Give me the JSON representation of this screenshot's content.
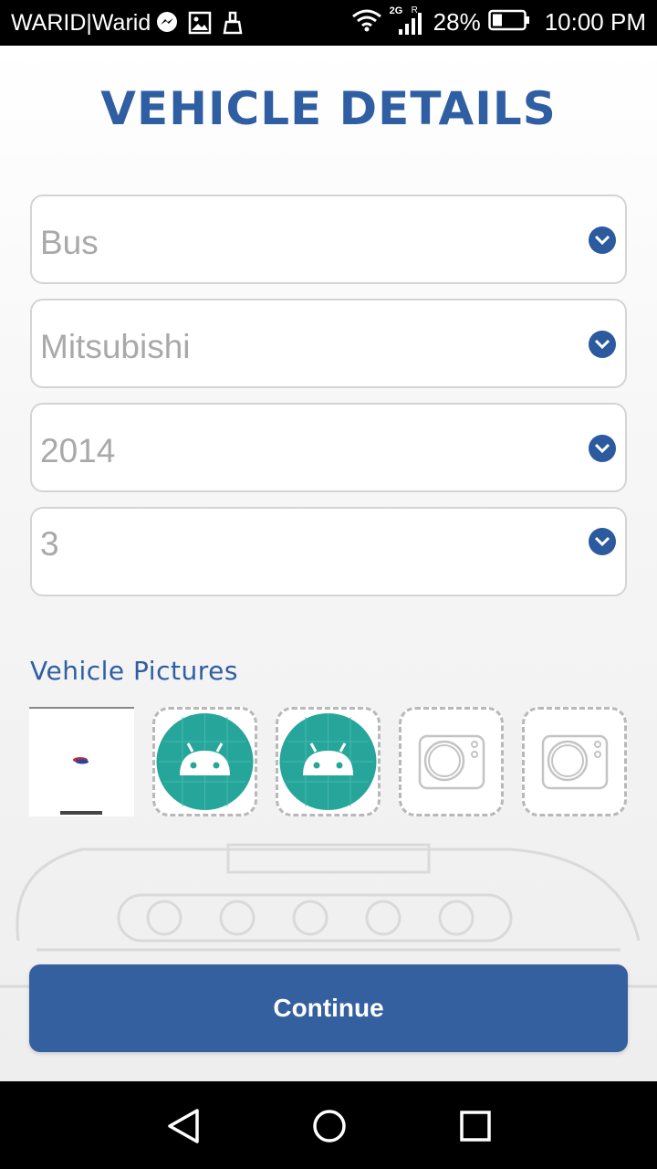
{
  "status_bar": {
    "carrier": "WARID|Warid",
    "network": "2G",
    "roaming": "R",
    "battery": "28%",
    "time": "10:00 PM",
    "icons": [
      "messenger-icon",
      "image-icon",
      "cleaner-icon",
      "wifi-icon",
      "signal-icon",
      "battery-icon"
    ]
  },
  "page": {
    "title": "VEHICLE DETAILS"
  },
  "form": {
    "vehicle_type": "Bus",
    "make": "Mitsubishi",
    "year": "2014",
    "count": "3"
  },
  "pictures": {
    "label": "Vehicle Pictures",
    "slots": [
      "photo",
      "android-placeholder",
      "android-placeholder",
      "camera-add",
      "camera-add"
    ]
  },
  "actions": {
    "continue_label": "Continue"
  },
  "colors": {
    "brand_blue": "#2f5ea3",
    "button_blue": "#34609f",
    "android_teal": "#26a69a"
  },
  "nav": {
    "icons": [
      "back-icon",
      "home-icon",
      "recents-icon"
    ]
  }
}
